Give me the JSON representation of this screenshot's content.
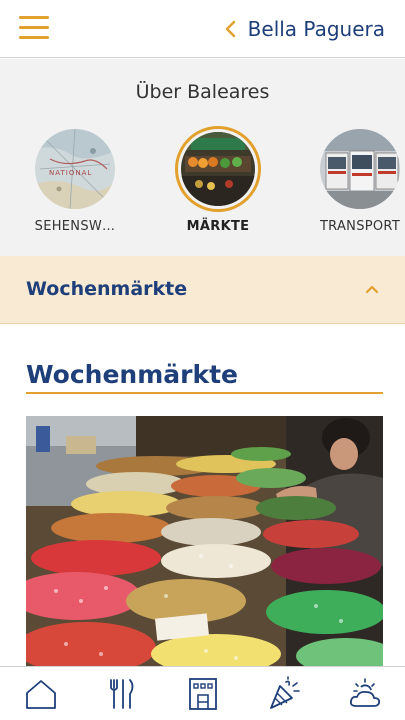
{
  "header": {
    "back_label": "Bella Paguera",
    "menu_icon": "hamburger-menu-icon",
    "back_icon": "chevron-left-icon"
  },
  "categories": {
    "title": "Über Baleares",
    "items": [
      {
        "label": "SEHENSW…",
        "image": "map-thumbnail",
        "active": false
      },
      {
        "label": "MÄRKTE",
        "image": "market-thumbnail",
        "active": true
      },
      {
        "label": "TRANSPORT",
        "image": "bus-thumbnail",
        "active": false
      }
    ]
  },
  "accordion": {
    "label": "Wochenmärkte",
    "state": "expanded",
    "icon": "chevron-up-icon"
  },
  "content": {
    "heading": "Wochenmärkte",
    "image": "market-candy-stall-photo"
  },
  "bottom_nav": {
    "items": [
      "home-icon",
      "restaurant-icon",
      "hotel-icon",
      "party-icon",
      "weather-icon"
    ]
  },
  "colors": {
    "accent": "#e2a02c",
    "brand_blue": "#1e3f7a",
    "accordion_bg": "#f8ead3",
    "strip_bg": "#f2f2f2",
    "nav_icon": "#1e3f7a"
  }
}
